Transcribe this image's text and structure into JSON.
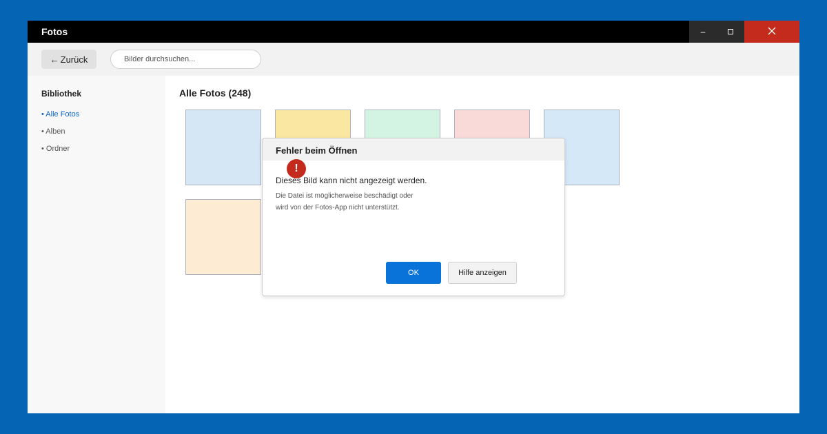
{
  "app": {
    "title": "Fotos"
  },
  "window_controls": {
    "minimize": "–",
    "maximize": "□",
    "close": "✕",
    "close_color": "#c42b1c"
  },
  "toolbar": {
    "back_arrow": "←",
    "back_label": "Zurück",
    "search_placeholder": "Bilder durchsuchen..."
  },
  "sidebar": {
    "title": "Bibliothek",
    "items": [
      {
        "label": "• Alle Fotos",
        "active": true
      },
      {
        "label": "• Alben",
        "active": false
      },
      {
        "label": "• Ordner",
        "active": false
      }
    ]
  },
  "main": {
    "title": "Alle Fotos (248)",
    "thumbnails": [
      {
        "color": "#d5e6f4"
      },
      {
        "color": "#fae7a1"
      },
      {
        "color": "#d4f4e3"
      },
      {
        "color": "#fad9d9"
      },
      {
        "color": "#d5e8f8"
      },
      {
        "color": "#fdebd3"
      }
    ]
  },
  "dialog": {
    "title": "Fehler beim Öffnen",
    "icon": "!",
    "message": "Dieses Bild kann nicht angezeigt werden.",
    "detail_line1": "Die Datei ist möglicherweise beschädigt oder",
    "detail_line2": "wird von der Fotos-App nicht unterstützt.",
    "ok_label": "OK",
    "help_label": "Hilfe anzeigen",
    "accent_color": "#0a73d9"
  },
  "colors": {
    "desktop": "#0664b5",
    "active_link": "#0a63c8"
  }
}
